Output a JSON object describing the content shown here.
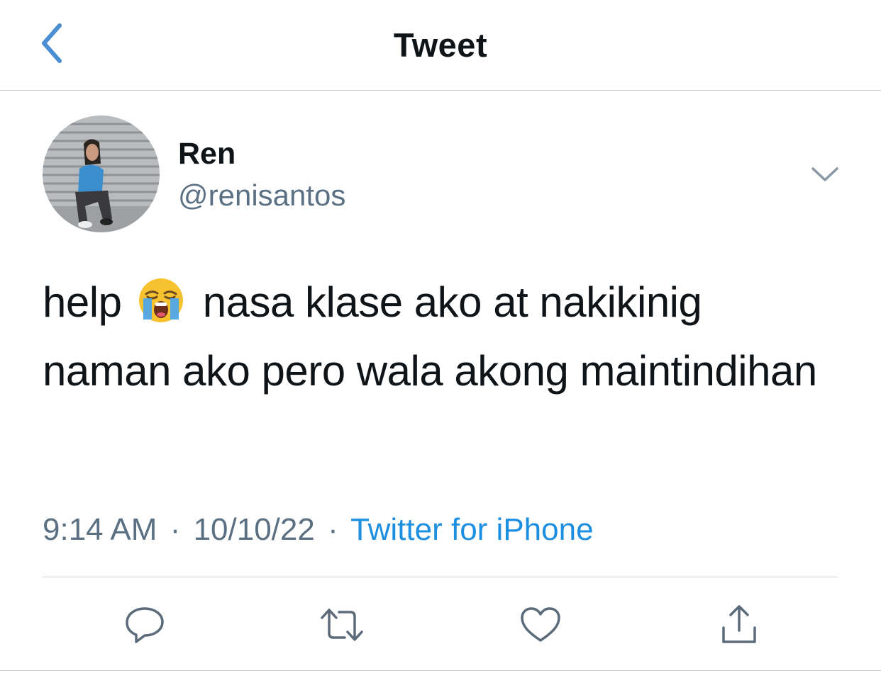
{
  "header": {
    "title": "Tweet",
    "back_icon": "chevron-left-icon"
  },
  "author": {
    "name": "Ren",
    "handle": "@renisantos"
  },
  "tweet": {
    "text_before_emoji": "help",
    "emoji": "loudly-crying-face",
    "text_after_emoji": "nasa klase ako at nakikinig naman ako pero wala akong maintindihan"
  },
  "meta": {
    "time": "9:14 AM",
    "separator": "·",
    "date": "10/10/22",
    "source": "Twitter for iPhone"
  },
  "actions": [
    {
      "icon": "reply-icon"
    },
    {
      "icon": "retweet-icon"
    },
    {
      "icon": "like-icon"
    },
    {
      "icon": "share-icon"
    }
  ],
  "colors": {
    "accent": "#1d8fe0",
    "back_chevron": "#4a8ed3",
    "secondary_text": "#5b7083"
  }
}
